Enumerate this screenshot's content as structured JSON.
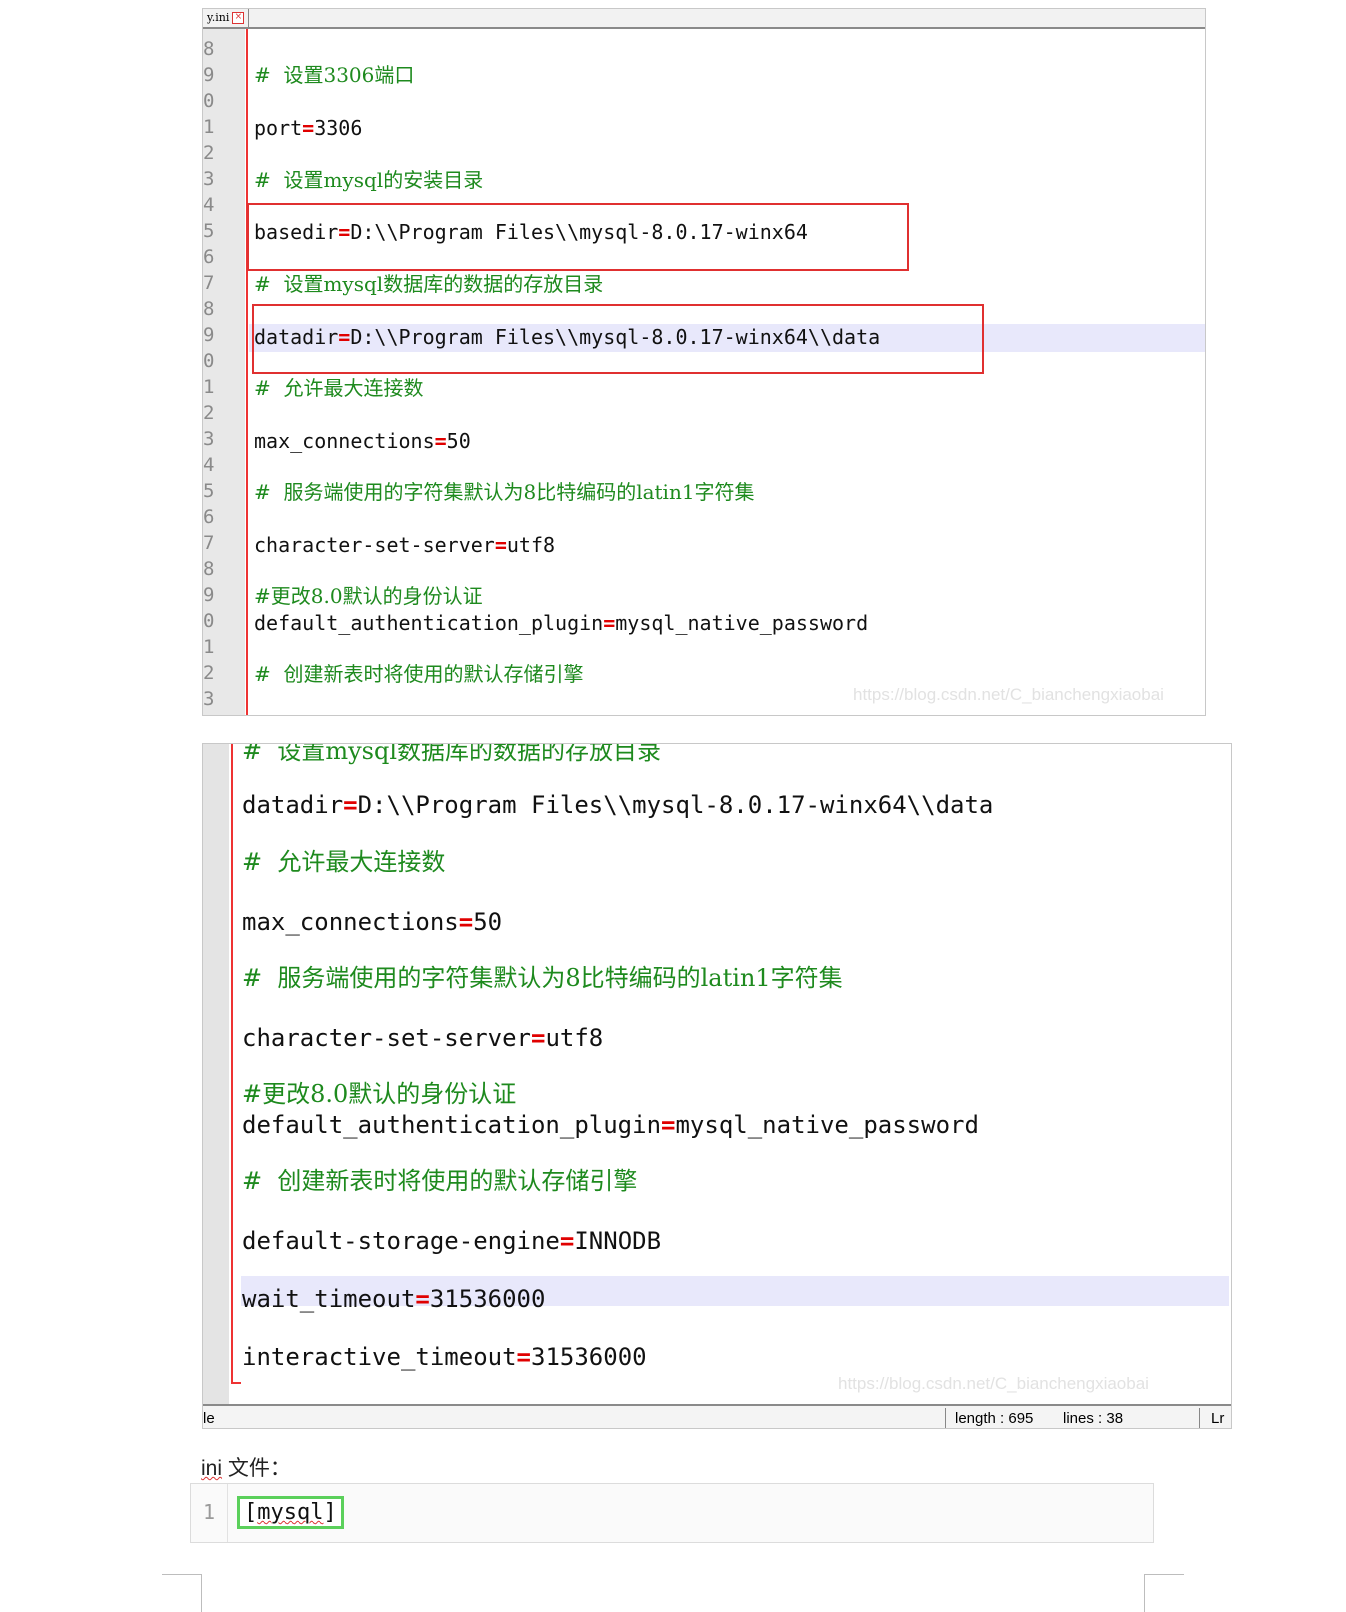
{
  "panel1": {
    "tab_label": "y.ini",
    "line_numbers": [
      "8",
      "9",
      "0",
      "1",
      "2",
      "3",
      "4",
      "5",
      "6",
      "7",
      "8",
      "9",
      "0",
      "1",
      "2",
      "3",
      "4",
      "5",
      "6",
      "7",
      "8",
      "9",
      "0",
      "1",
      "2",
      "3"
    ],
    "lines": {
      "c1": "#  设置3306端口",
      "port_key": "port",
      "port_val": "3306",
      "c2": "#  设置mysql的安装目录",
      "basedir_key": "basedir",
      "basedir_val": "D:\\\\Program Files\\\\mysql-8.0.17-winx64",
      "c3": "#  设置mysql数据库的数据的存放目录",
      "datadir_key": "datadir",
      "datadir_val": "D:\\\\Program Files\\\\mysql-8.0.17-winx64\\\\data",
      "c4": "#  允许最大连接数",
      "maxconn_key": "max_connections",
      "maxconn_val": "50",
      "c5": "#  服务端使用的字符集默认为8比特编码的latin1字符集",
      "charset_key": "character-set-server",
      "charset_val": "utf8",
      "c6": "#更改8.0默认的身份认证",
      "auth_key": "default_authentication_plugin",
      "auth_val": "mysql_native_password",
      "c7": "#  创建新表时将使用的默认存储引擎"
    },
    "eq": "=",
    "watermark": "https://blog.csdn.net/C_bianchengxiaobai"
  },
  "panel2": {
    "lines": {
      "c3": "#  设置mysql数据库的数据的存放目录",
      "datadir_key": "datadir",
      "datadir_val": "D:\\\\Program Files\\\\mysql-8.0.17-winx64\\\\data",
      "c4": "#  允许最大连接数",
      "maxconn_key": "max_connections",
      "maxconn_val": "50",
      "c5": "#  服务端使用的字符集默认为8比特编码的latin1字符集",
      "charset_key": "character-set-server",
      "charset_val": "utf8",
      "c6": "#更改8.0默认的身份认证",
      "auth_key": "default_authentication_plugin",
      "auth_val": "mysql_native_password",
      "c7": "#  创建新表时将使用的默认存储引擎",
      "engine_key": "default-storage-engine",
      "engine_val": "INNODB",
      "wait_key": "wait_timeout",
      "wait_val": "31536000",
      "inter_key": "interactive_timeout",
      "inter_val": "31536000"
    },
    "eq": "=",
    "status": {
      "left": "le",
      "length": "length : 695",
      "lines": "lines : 38",
      "right": "Lr"
    },
    "watermark": "https://blog.csdn.net/C_bianchengxiaobai"
  },
  "ini_label": {
    "prefix": "ini",
    "suffix": " 文件："
  },
  "codeblock": {
    "line_number": "1",
    "code_prefix": "[",
    "code_word": "mysql",
    "code_suffix": "]"
  }
}
